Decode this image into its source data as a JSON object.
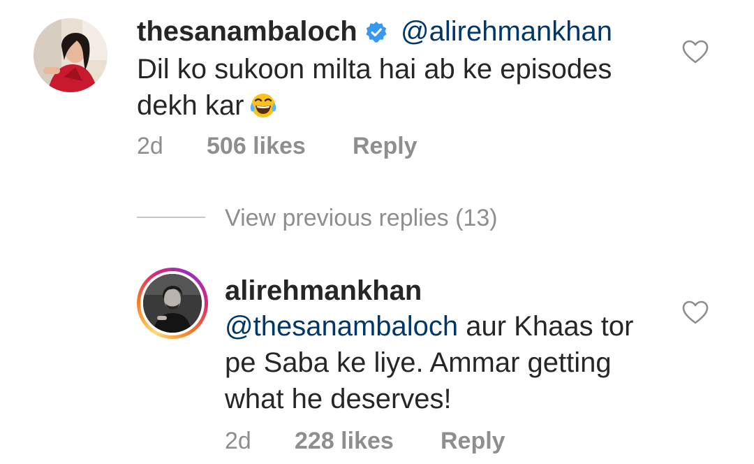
{
  "comment": {
    "username": "thesanambaloch",
    "verified_icon": "verified-badge-icon",
    "mention": "@alirehmankhan",
    "text": "Dil ko sukoon milta hai ab ke episodes dekh kar",
    "emoji": "face-with-tears-of-joy",
    "time": "2d",
    "likes": "506 likes",
    "reply_label": "Reply",
    "like_icon": "heart-outline-icon"
  },
  "view_previous_replies": "View previous replies (13)",
  "reply": {
    "username": "alirehmankhan",
    "has_story_ring": true,
    "mention": "@thesanambaloch",
    "text": " aur Khaas tor pe Saba ke liye. Ammar getting what he deserves!",
    "time": "2d",
    "likes": "228 likes",
    "reply_label": "Reply",
    "like_icon": "heart-outline-icon"
  },
  "colors": {
    "text": "#262626",
    "mention": "#00376b",
    "meta": "#8e8e8e",
    "verified": "#3897f0",
    "heart_outline": "#8e8e8e"
  }
}
